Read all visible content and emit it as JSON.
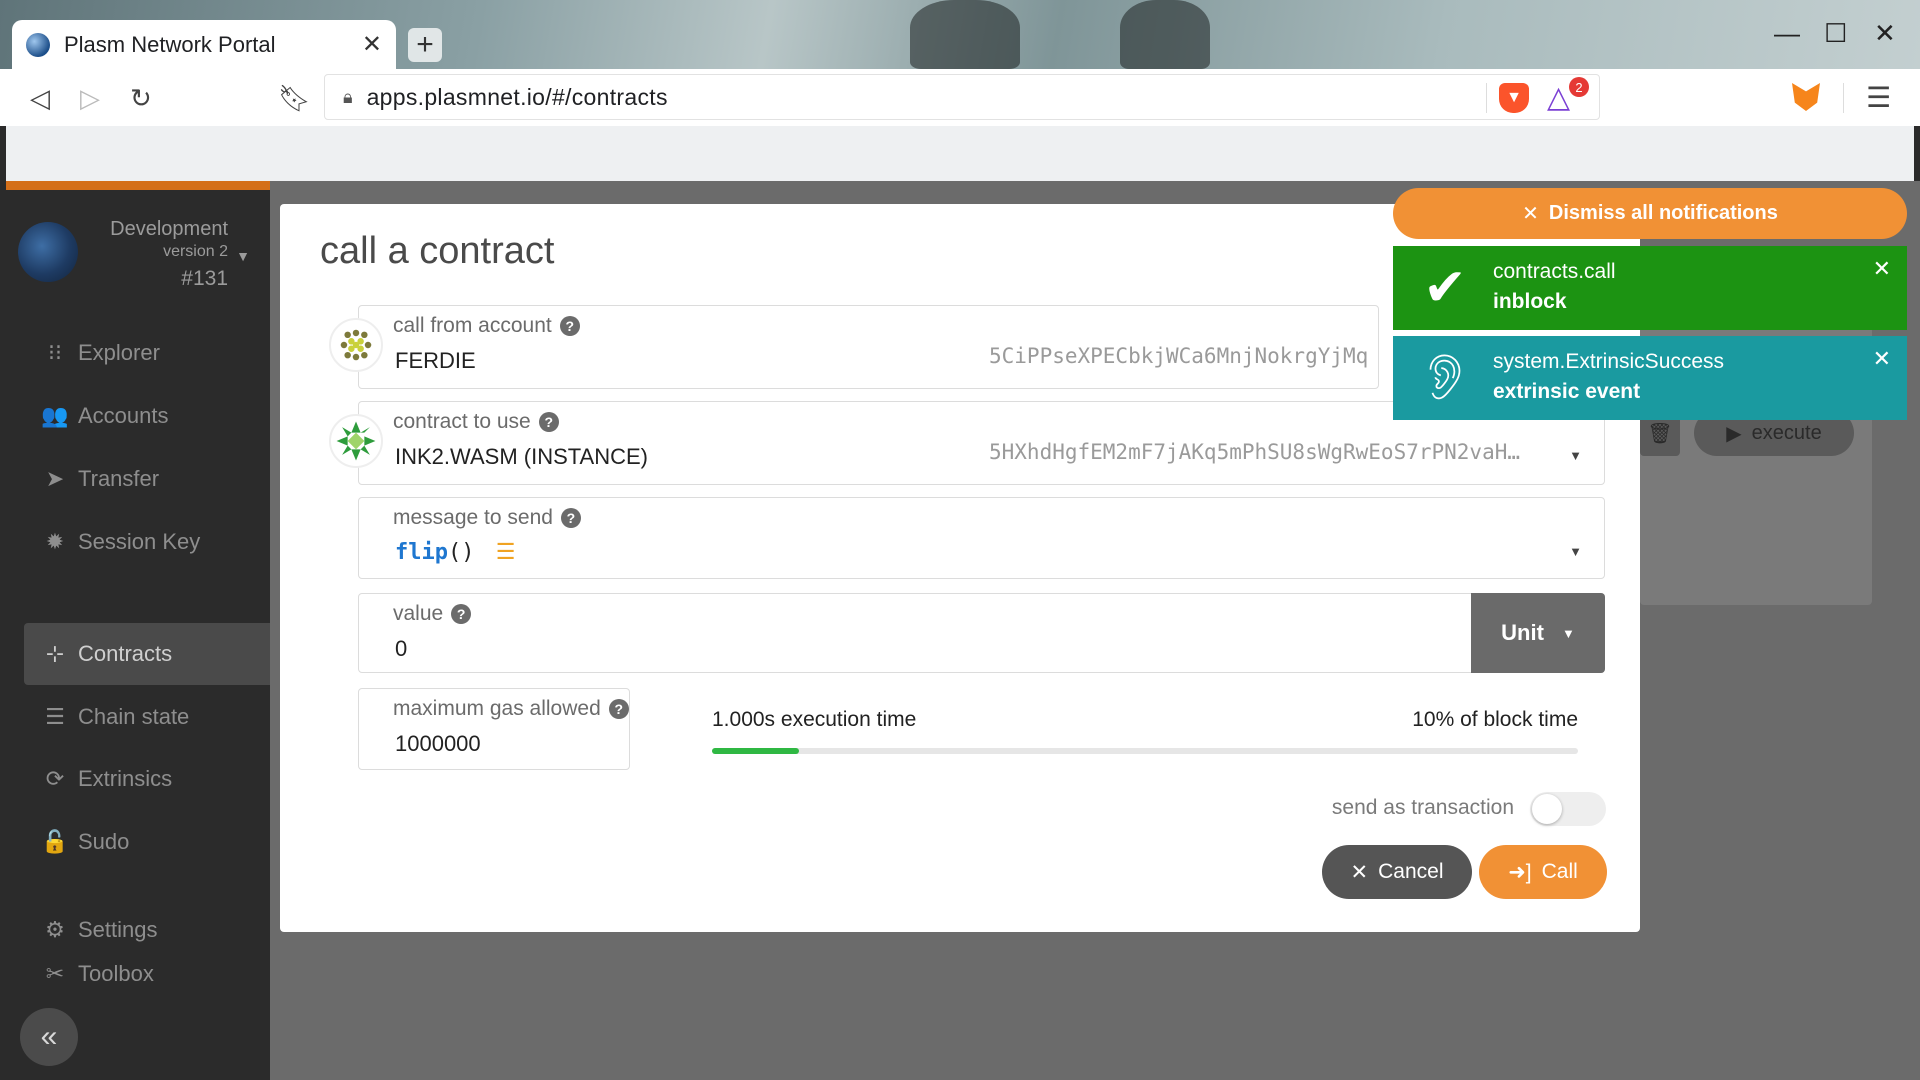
{
  "browser": {
    "tab_title": "Plasm Network Portal",
    "tab_close": "✕",
    "new_tab": "+",
    "url": "apps.plasmnet.io/#/contracts",
    "rewards_badge": "2",
    "window_controls": {
      "minimize": "—",
      "maximize": "☐",
      "close": "✕"
    }
  },
  "sidebar": {
    "chain_name": "Development",
    "chain_version": "version 2",
    "block": "#131",
    "items": [
      {
        "label": "Explorer",
        "icon": "explorer-icon",
        "glyph": "⁝⁝"
      },
      {
        "label": "Accounts",
        "icon": "users-icon",
        "glyph": "👥"
      },
      {
        "label": "Transfer",
        "icon": "send-icon",
        "glyph": "➤"
      },
      {
        "label": "Session Key",
        "icon": "cog-icon",
        "glyph": "✹"
      },
      {
        "label": "Contracts",
        "icon": "compress-icon",
        "glyph": "⊹"
      },
      {
        "label": "Chain state",
        "icon": "database-icon",
        "glyph": "☰"
      },
      {
        "label": "Extrinsics",
        "icon": "sync-icon",
        "glyph": "⟳"
      },
      {
        "label": "Sudo",
        "icon": "unlock-icon",
        "glyph": "🔓"
      },
      {
        "label": "Settings",
        "icon": "cogs-icon",
        "glyph": "⚙"
      },
      {
        "label": "Toolbox",
        "icon": "toolbox-icon",
        "glyph": "✂"
      }
    ],
    "collapse_glyph": "«"
  },
  "background": {
    "execute_label": "execute"
  },
  "modal": {
    "title": "call a contract",
    "account": {
      "label": "call from account",
      "name": "FERDIE",
      "address": "5CiPPseXPECbkjWCa6MnjNokrgYjMq"
    },
    "contract": {
      "label": "contract to use",
      "name": "INK2.WASM (INSTANCE)",
      "address": "5HXhdHgfEM2mF7jAKq5mPhSU8sWgRwEoS7rPN2vaH…"
    },
    "message": {
      "label": "message to send",
      "fn_name": "flip",
      "fn_parens": "()"
    },
    "value": {
      "label": "value",
      "amount": "0",
      "unit": "Unit"
    },
    "gas": {
      "label": "maximum gas allowed",
      "amount": "1000000",
      "execution_time": "1.000s execution time",
      "block_time": "10% of block time",
      "block_time_fraction": 0.1
    },
    "send_as_transaction": {
      "label": "send as transaction",
      "enabled": false
    },
    "cancel_label": "Cancel",
    "call_label": "Call"
  },
  "notifications": {
    "dismiss_label": "Dismiss all notifications",
    "items": [
      {
        "title": "contracts.call",
        "status": "inblock",
        "color": "#1c9312",
        "icon": "check-icon"
      },
      {
        "title": "system.ExtrinsicSuccess",
        "status": "extrinsic event",
        "color": "#1a9aa0",
        "icon": "listen-icon"
      }
    ]
  },
  "colors": {
    "accent": "#f19135",
    "sidebar_border": "#d46f19",
    "progress": "#2fb843"
  }
}
